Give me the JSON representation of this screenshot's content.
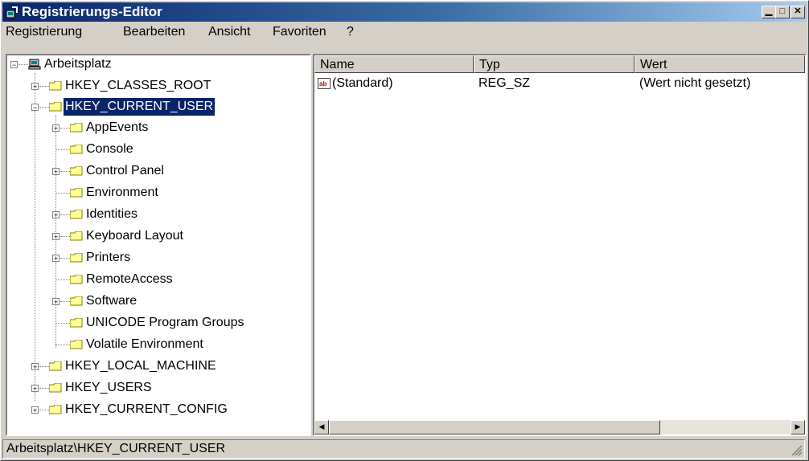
{
  "window": {
    "title": "Registrierungs-Editor"
  },
  "menubar": {
    "items": [
      "Registrierung",
      "Bearbeiten",
      "Ansicht",
      "Favoriten",
      "?"
    ]
  },
  "tree": {
    "root": "Arbeitsplatz",
    "hives": [
      "HKEY_CLASSES_ROOT",
      "HKEY_CURRENT_USER",
      "HKEY_LOCAL_MACHINE",
      "HKEY_USERS",
      "HKEY_CURRENT_CONFIG"
    ],
    "hkcu_children": [
      "AppEvents",
      "Console",
      "Control Panel",
      "Environment",
      "Identities",
      "Keyboard Layout",
      "Printers",
      "RemoteAccess",
      "Software",
      "UNICODE Program Groups",
      "Volatile Environment"
    ],
    "selected": "HKEY_CURRENT_USER"
  },
  "list": {
    "columns": [
      "Name",
      "Typ",
      "Wert"
    ],
    "rows": [
      {
        "name": "(Standard)",
        "type": "REG_SZ",
        "value": "(Wert nicht gesetzt)"
      }
    ]
  },
  "statusbar": {
    "path": "Arbeitsplatz\\HKEY_CURRENT_USER"
  },
  "colors": {
    "title_start": "#0a246a",
    "title_end": "#a6caf0",
    "selection": "#0a246a",
    "face": "#d4d0c8"
  },
  "icons": [
    "regedit-icon",
    "computer-icon",
    "folder-icon",
    "string-value-icon",
    "minimize-icon",
    "maximize-icon",
    "close-icon"
  ]
}
